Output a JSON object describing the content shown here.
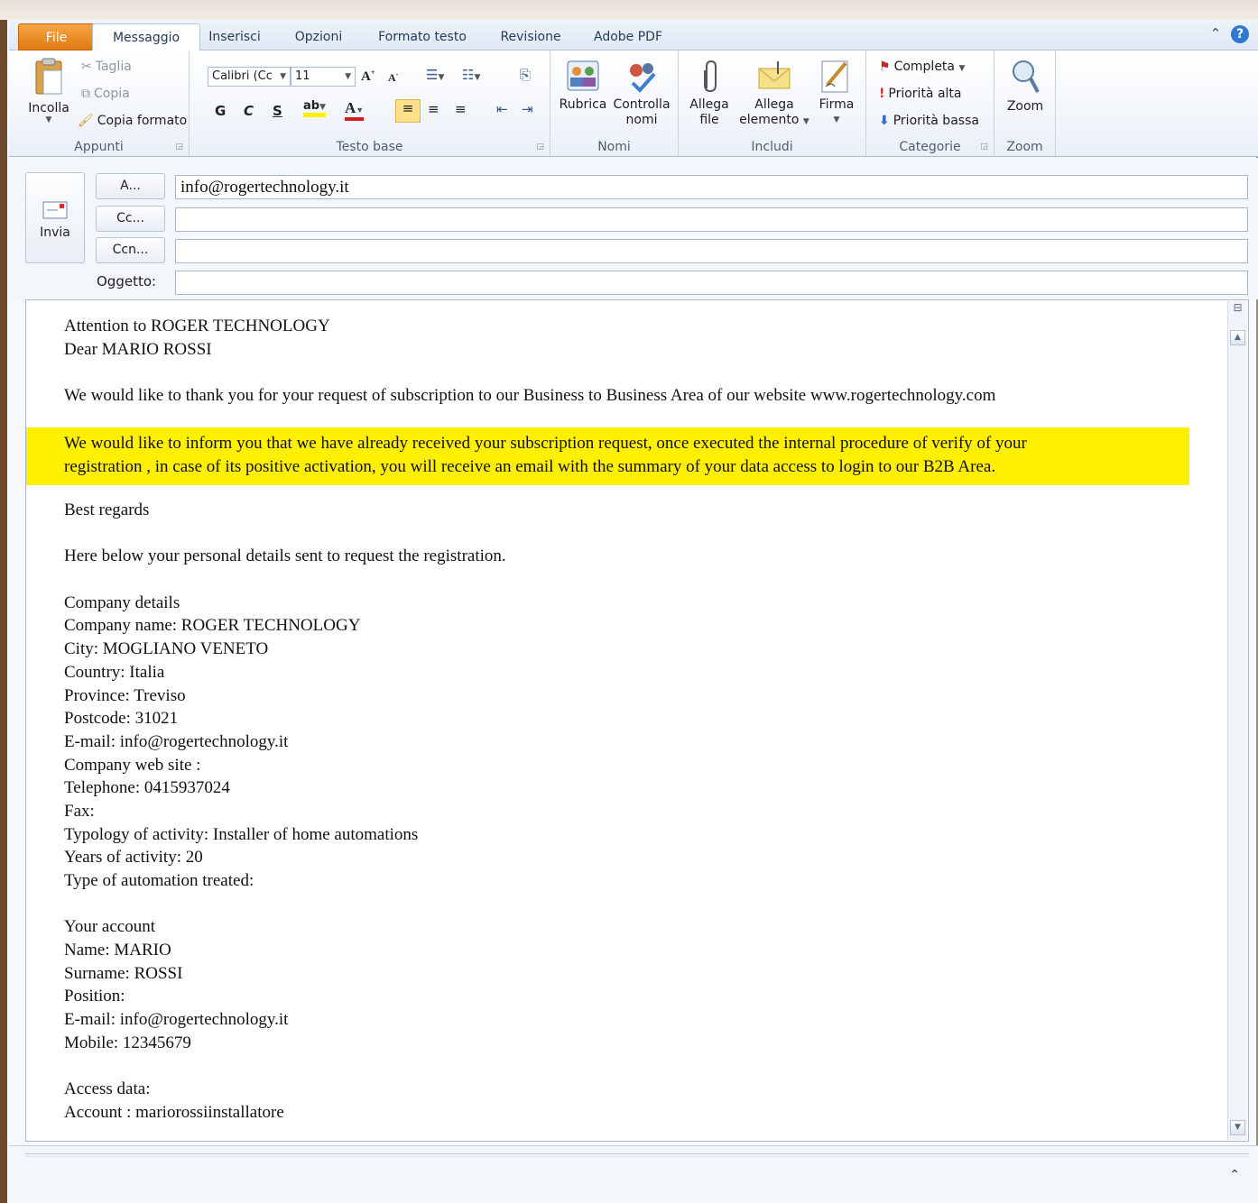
{
  "tabs": {
    "file": "File",
    "items": [
      "Messaggio",
      "Inserisci",
      "Opzioni",
      "Formato testo",
      "Revisione",
      "Adobe PDF"
    ],
    "active": "Messaggio"
  },
  "ribbon": {
    "appunti": {
      "paste": "Incolla",
      "cut": "Taglia",
      "copy": "Copia",
      "format_painter": "Copia formato",
      "label": "Appunti"
    },
    "testo_base": {
      "font_name": "Calibri (Cc",
      "font_size": "11",
      "bold": "G",
      "italic": "C",
      "underline": "S",
      "label": "Testo base"
    },
    "nomi": {
      "address_book": "Rubrica",
      "check_names_1": "Controlla",
      "check_names_2": "nomi",
      "label": "Nomi"
    },
    "includi": {
      "attach_file_1": "Allega",
      "attach_file_2": "file",
      "attach_item_1": "Allega",
      "attach_item_2": "elemento",
      "signature": "Firma",
      "label": "Includi"
    },
    "categorie": {
      "follow_up": "Completa",
      "high": "Priorità alta",
      "low": "Priorità bassa",
      "label": "Categorie"
    },
    "zoom": {
      "zoom": "Zoom",
      "label": "Zoom"
    }
  },
  "header": {
    "send": "Invia",
    "to_btn": "A...",
    "cc_btn": "Cc...",
    "bcc_btn": "Ccn...",
    "subject_label": "Oggetto:",
    "to_value": "info@rogertechnology.it",
    "cc_value": "",
    "bcc_value": "",
    "subject_value": ""
  },
  "body": {
    "lines_top": [
      "Attention to ROGER TECHNOLOGY",
      "Dear MARIO ROSSI",
      "",
      "We would like to thank you for your request of subscription to our Business to Business Area of our website www.rogertechnology.com"
    ],
    "highlight_lines": [
      "We would like to inform you that we have already received your subscription request, once executed the internal procedure of verify of your",
      "registration , in case of its positive activation, you will receive an email with the summary of your data access to login to our B2B Area."
    ],
    "lines_bottom": [
      "Best regards",
      "",
      "Here below your personal details sent to request the registration.",
      "",
      "Company details",
      "Company name: ROGER TECHNOLOGY",
      "City: MOGLIANO VENETO",
      "Country: Italia",
      "Province: Treviso",
      "Postcode: 31021",
      "E-mail: info@rogertechnology.it",
      "Company web site :",
      "Telephone: 0415937024",
      "Fax:",
      "Typology of activity: Installer of home automations",
      "Years of activity: 20",
      "Type of automation treated:",
      "",
      "Your account",
      "Name: MARIO",
      "Surname: ROSSI",
      "Position:",
      "E-mail: info@rogertechnology.it",
      "Mobile: 12345679",
      "",
      "Access data:",
      "Account : mariorossiinstallatore"
    ]
  },
  "colors": {
    "highlight": "#ffef00",
    "file_tab": "#e98a1e",
    "help": "#2f77d0"
  }
}
